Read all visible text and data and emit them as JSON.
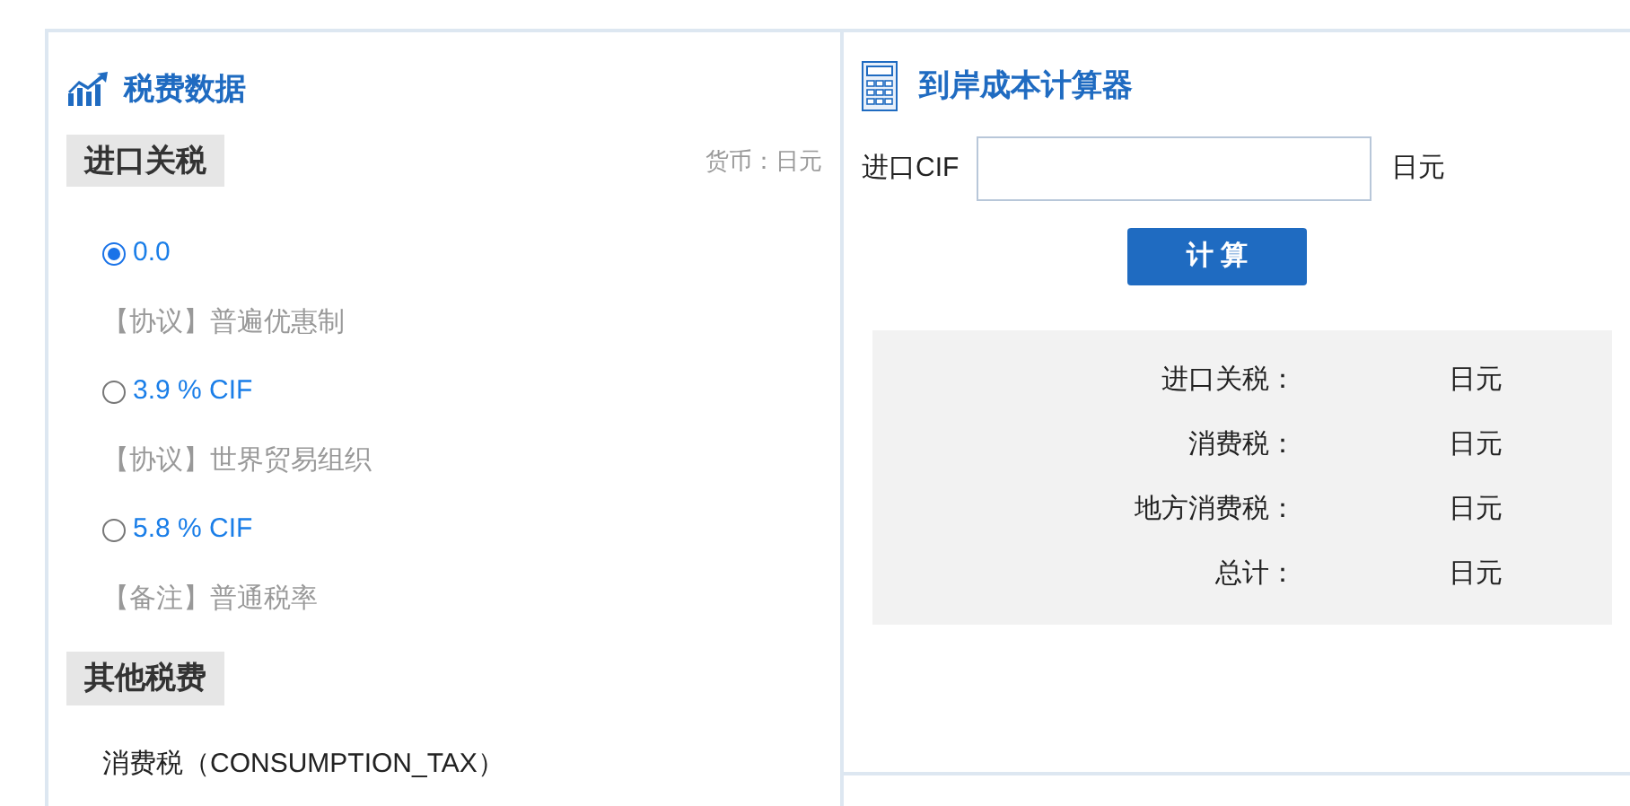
{
  "tax_panel": {
    "title": "税费数据",
    "sections": [
      {
        "heading": "进口关税",
        "currency": "货币：日元",
        "options": [
          {
            "rate": "0.0",
            "note": "【协议】普遍优惠制",
            "selected": true
          },
          {
            "rate": "3.9 % CIF",
            "note": "【协议】世界贸易组织",
            "selected": false
          },
          {
            "rate": "5.8 % CIF",
            "note": "【备注】普通税率",
            "selected": false
          }
        ]
      },
      {
        "heading": "其他税费",
        "items": [
          "消费税（CONSUMPTION_TAX）"
        ]
      }
    ]
  },
  "calculator": {
    "title": "到岸成本计算器",
    "input_label": "进口CIF",
    "input_unit": "日元",
    "button": "计 算",
    "results": [
      {
        "label": "进口关税：",
        "unit": "日元"
      },
      {
        "label": "消费税：",
        "unit": "日元"
      },
      {
        "label": "地方消费税：",
        "unit": "日元"
      },
      {
        "label": "总计：",
        "unit": "日元"
      }
    ]
  }
}
